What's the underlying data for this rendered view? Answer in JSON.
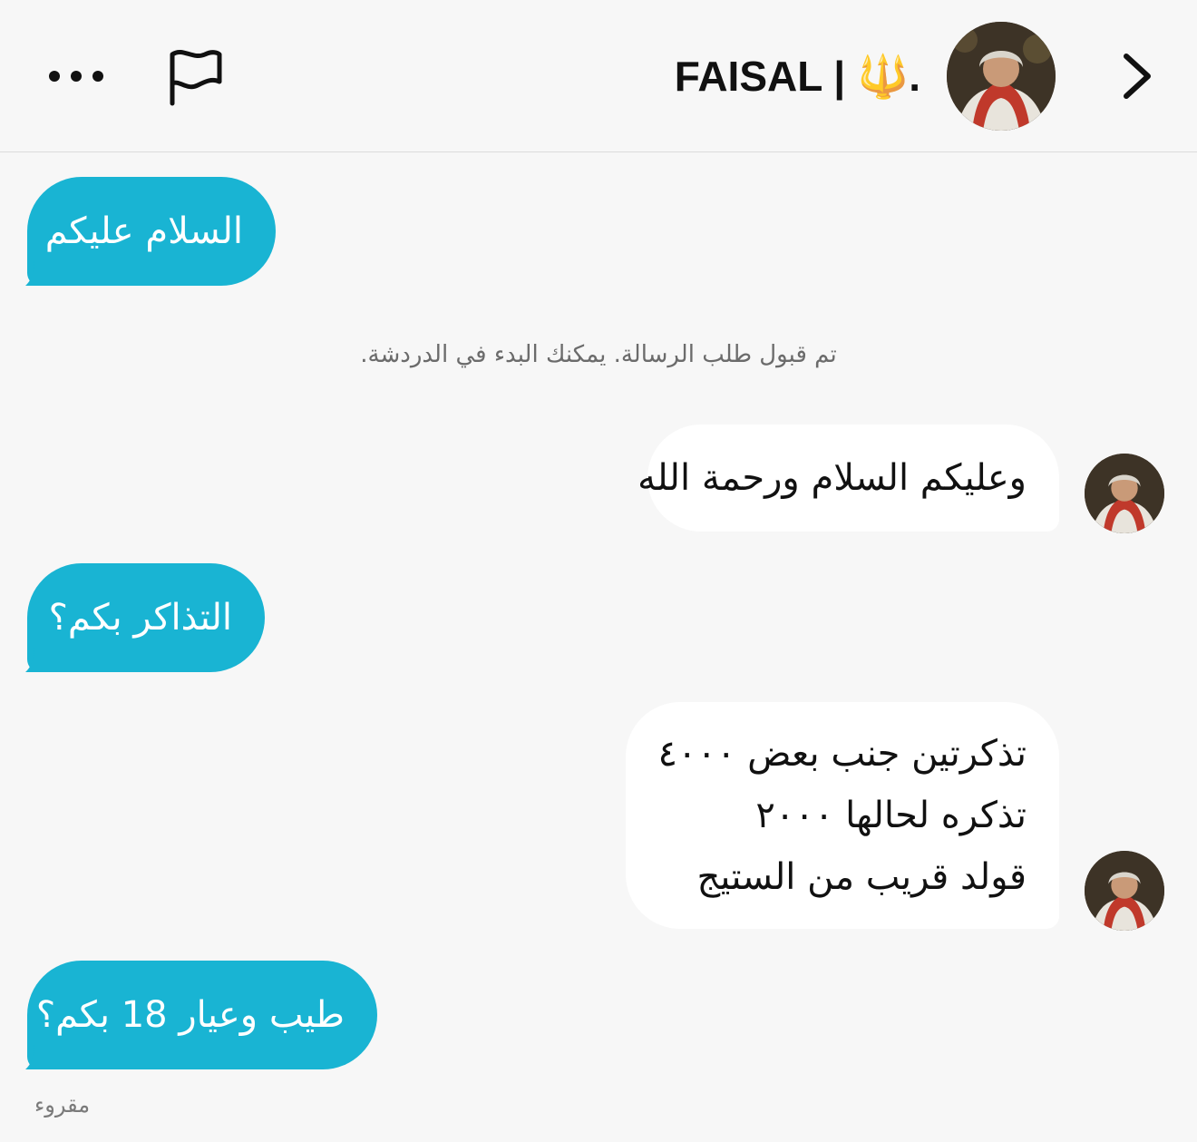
{
  "header": {
    "title": "FAISAL | 🔱.",
    "more_icon": "more-horizontal-icon",
    "flag_icon": "flag-icon",
    "chevron_icon": "chevron-right-icon"
  },
  "messages": [
    {
      "from": "me",
      "text": "السلام عليكم"
    },
    {
      "from": "system",
      "text": "تم قبول طلب الرسالة. يمكنك البدء في الدردشة."
    },
    {
      "from": "them",
      "text": "وعليكم السلام ورحمة الله"
    },
    {
      "from": "me",
      "text": "التذاكر بكم؟"
    },
    {
      "from": "them",
      "lines": [
        "تذكرتين جنب بعض ٤٠٠٠",
        "تذكره لحالها  ٢٠٠٠",
        "قولد قريب من الستيج"
      ]
    },
    {
      "from": "me",
      "text": "طيب وعيار 18 بكم؟"
    }
  ],
  "read_status": "مقروء",
  "colors": {
    "outgoing_bubble": "#19b4d3",
    "incoming_bubble": "#ffffff",
    "background": "#f7f7f7"
  }
}
